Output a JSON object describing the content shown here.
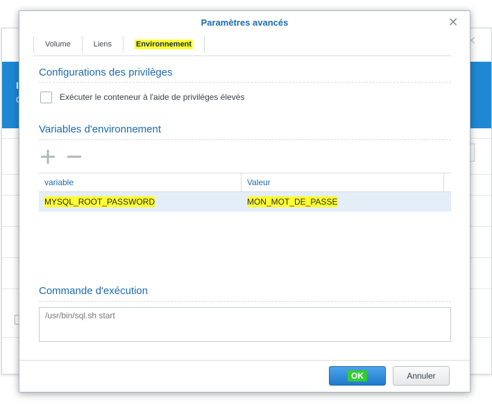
{
  "dialog": {
    "title": "Paramètres avancés",
    "tabs": [
      {
        "label": "Volume",
        "active": false
      },
      {
        "label": "Liens",
        "active": false
      },
      {
        "label": "Environnement",
        "active": true
      }
    ]
  },
  "privileges": {
    "title": "Configurations des privilèges",
    "checkbox_label": "Exécuter le conteneur à l'aide de privilèges élevés",
    "checked": false
  },
  "env": {
    "title": "Variables d'environnement",
    "columns": [
      "variable",
      "Valeur"
    ],
    "rows": [
      {
        "variable": "MYSQL_ROOT_PASSWORD",
        "value": "MON_MOT_DE_PASSE"
      }
    ]
  },
  "command": {
    "title": "Commande d'exécution",
    "placeholder": "/usr/bin/sql.sh start"
  },
  "buttons": {
    "ok": "OK",
    "cancel": "Annuler"
  },
  "colors": {
    "accent": "#1a6ab0",
    "highlight": "#ffff33",
    "ok_highlight": "#33cc33"
  }
}
